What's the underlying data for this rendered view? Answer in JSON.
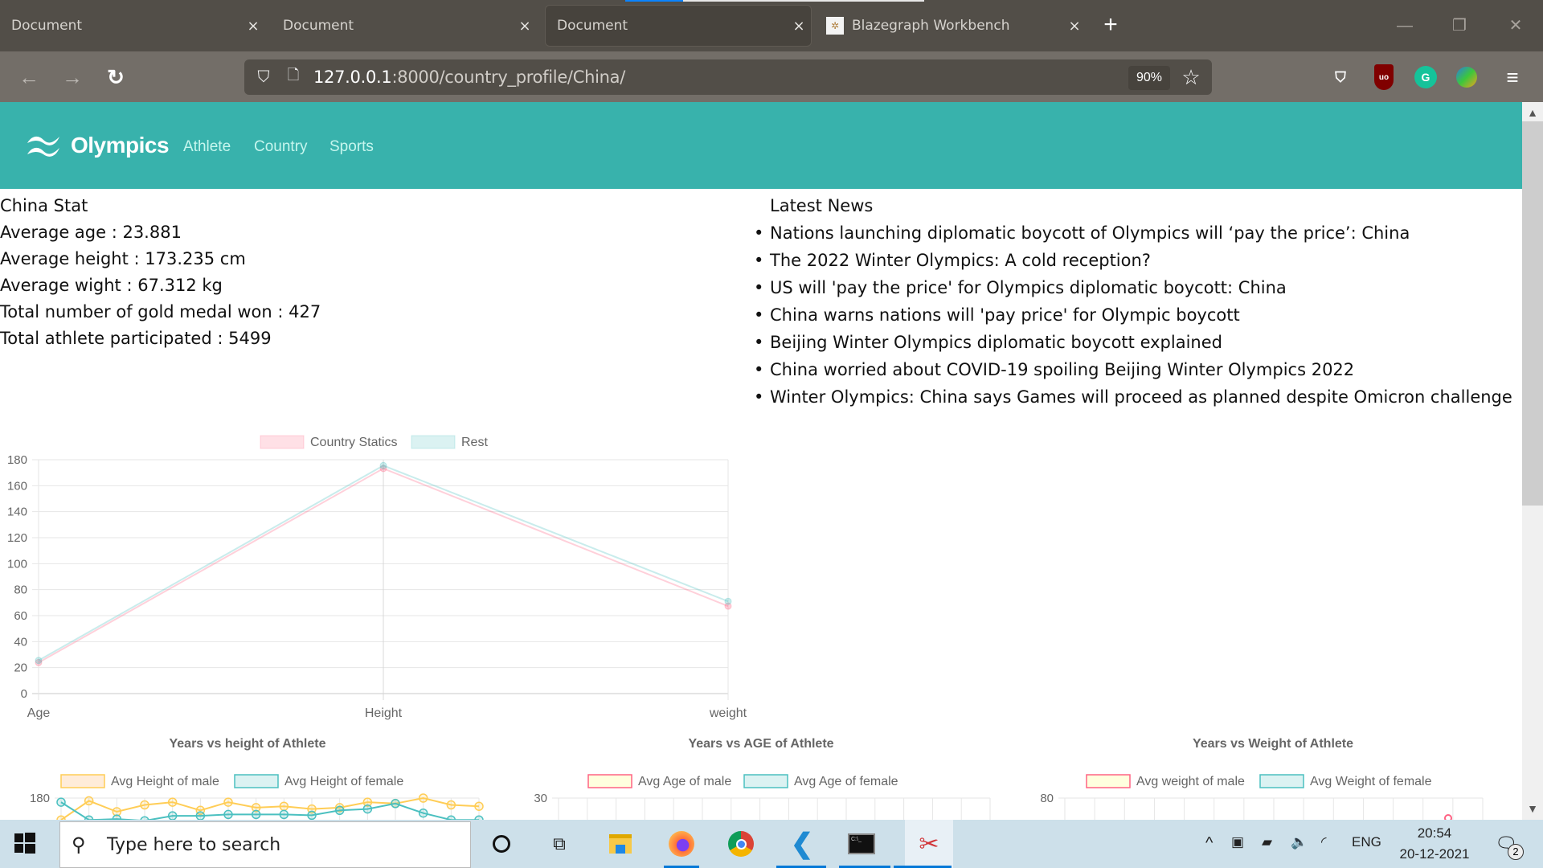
{
  "browser": {
    "tabs": [
      {
        "label": "Document",
        "active": false
      },
      {
        "label": "Document",
        "active": false
      },
      {
        "label": "Document",
        "active": true
      },
      {
        "label": "Blazegraph Workbench",
        "active": false
      }
    ],
    "close_glyph": "×",
    "new_tab_glyph": "+",
    "window_controls": {
      "minimize": "—",
      "restore": "❐",
      "close": "✕"
    },
    "nav": {
      "back": "←",
      "forward": "→",
      "reload": "↻"
    },
    "url_host": "127.0.0.1",
    "url_rest": ":8000/country_profile/China/",
    "zoom_level": "90%",
    "bookmark_glyph": "☆",
    "extensions": [
      "pocket-icon",
      "ublock-icon",
      "grammarly-icon",
      "idm-icon"
    ],
    "menu_glyph": "≡"
  },
  "site": {
    "brand": "Olympics",
    "nav_links": [
      "Athlete",
      "Country",
      "Sports"
    ],
    "accent_color": "#38b2ac"
  },
  "stats": {
    "title": "China Stat",
    "lines": [
      "Average age : 23.881",
      "Average height : 173.235 cm",
      "Average wight : 67.312 kg",
      "Total number of gold medal won : 427",
      "Total athlete participated : 5499"
    ]
  },
  "news": {
    "title": "Latest News",
    "items": [
      "Nations launching diplomatic boycott of Olympics will ‘pay the price’: China",
      "The 2022 Winter Olympics: A cold reception?",
      "US will 'pay the price' for Olympics diplomatic boycott: China",
      "China warns nations will 'pay price' for Olympic boycott",
      "Beijing Winter Olympics diplomatic boycott explained",
      "China worried about COVID-19 spoiling Beijing Winter Olympics 2022",
      "Winter Olympics: China says Games will proceed as planned despite Omicron challenge"
    ]
  },
  "chart_data": [
    {
      "type": "line",
      "title": "",
      "categories": [
        "Age",
        "Height",
        "weight"
      ],
      "series": [
        {
          "name": "Country Statics",
          "values": [
            23.881,
            173.235,
            67.312
          ],
          "color": "#ff6384"
        },
        {
          "name": "Rest",
          "values": [
            25.5,
            175.5,
            71.0
          ],
          "color": "#4bc0c0"
        }
      ],
      "ylim": [
        0,
        180
      ],
      "yticks": [
        0,
        20,
        40,
        60,
        80,
        100,
        120,
        140,
        160,
        180
      ],
      "legend": "top",
      "grid": true
    },
    {
      "type": "line",
      "title": "Years vs height of Athlete",
      "series": [
        {
          "name": "Avg Height of male",
          "values": [
            172,
            179,
            175,
            177.5,
            178.5,
            175.5,
            178.5,
            176.5,
            177,
            176,
            176.5,
            178.5,
            178,
            180,
            177.5,
            177
          ],
          "color": "#ffcd56"
        },
        {
          "name": "Avg Height of female",
          "values": [
            178.5,
            172,
            172.3,
            171.7,
            173.5,
            173.5,
            174,
            174,
            174,
            173.7,
            175.5,
            176,
            178,
            174.5,
            172,
            172
          ],
          "color": "#4bc0c0"
        }
      ],
      "yticks_visible": [
        180
      ],
      "legend": "top",
      "grid": true
    },
    {
      "type": "line",
      "title": "Years vs AGE of Athlete",
      "series": [
        {
          "name": "Avg Age of male",
          "values": [],
          "color": "#ff6384"
        },
        {
          "name": "Avg Age of female",
          "values": [],
          "color": "#4bc0c0"
        }
      ],
      "yticks_visible": [
        30
      ],
      "legend": "top",
      "grid": true
    },
    {
      "type": "line",
      "title": "Years vs Weight of Athlete",
      "series": [
        {
          "name": "Avg weight of male",
          "values": [],
          "color": "#ff6384"
        },
        {
          "name": "Avg Weight of female",
          "values": [],
          "color": "#4bc0c0"
        }
      ],
      "yticks_visible": [
        80
      ],
      "legend": "top",
      "grid": true
    }
  ],
  "taskbar": {
    "search_placeholder": "Type here to search",
    "tray_lang": "ENG",
    "time": "20:54",
    "date": "20-12-2021",
    "notifications": "2",
    "chevron": "^"
  }
}
